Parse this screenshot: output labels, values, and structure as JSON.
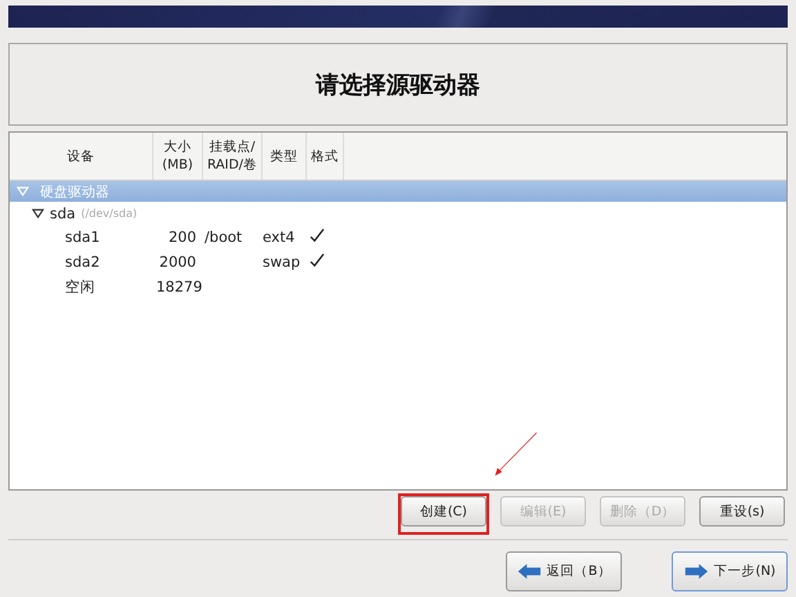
{
  "title": "请选择源驱动器",
  "table": {
    "columns": [
      {
        "label": "设备"
      },
      {
        "label": "大小\n(MB)"
      },
      {
        "label": "挂载点/\nRAID/卷"
      },
      {
        "label": "类型"
      },
      {
        "label": "格式"
      }
    ],
    "tree": [
      {
        "label": "硬盘驱动器",
        "expanded": true,
        "selected": true,
        "children": [
          {
            "label": "sda",
            "sublabel": "(/dev/sda)",
            "expanded": true,
            "selected": false,
            "children": [
              {
                "device": "sda1",
                "size": "200",
                "mount": "/boot",
                "type": "ext4",
                "format": true,
                "selected": false
              },
              {
                "device": "sda2",
                "size": "2000",
                "type": "swap",
                "format": true,
                "selected": false
              },
              {
                "device": "空闲",
                "size": "18279",
                "format": false,
                "selected": false
              }
            ]
          }
        ]
      }
    ]
  },
  "actions": [
    {
      "label": "创建(C)",
      "disabled": false,
      "highlighted": true
    },
    {
      "label": "编辑(E)",
      "disabled": true,
      "highlighted": false
    },
    {
      "label": "删除（D）",
      "disabled": true,
      "highlighted": false
    },
    {
      "label": "重设(s)",
      "disabled": false,
      "highlighted": false
    }
  ],
  "nav": [
    {
      "kind": "back",
      "label": "返回（B）"
    },
    {
      "kind": "next",
      "label": "下一步(N)"
    }
  ]
}
